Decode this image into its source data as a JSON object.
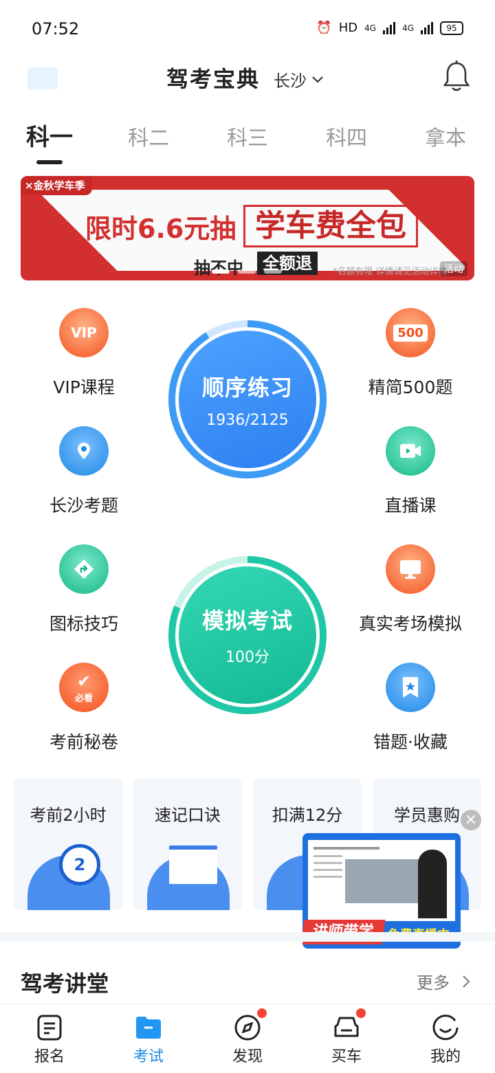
{
  "status_bar": {
    "time": "07:52",
    "network_1": "4G",
    "network_2": "4G",
    "hd": "HD",
    "battery": "95"
  },
  "header": {
    "title": "驾考宝典",
    "city": "长沙"
  },
  "tabs": [
    {
      "label": "科一",
      "active": true
    },
    {
      "label": "科二",
      "active": false
    },
    {
      "label": "科三",
      "active": false
    },
    {
      "label": "科四",
      "active": false
    },
    {
      "label": "拿本",
      "active": false
    }
  ],
  "banner": {
    "tag": "×金秋学车季",
    "main": "限时6.6元抽",
    "box": "学车费全包",
    "sub": "抽不中",
    "sub_box": "全额退",
    "note": "*名额有限 详情请见活动详情",
    "corner": "活动"
  },
  "features": {
    "vip": "VIP课程",
    "jingjian": "精简500题",
    "jingjian_icon": "500",
    "local": "长沙考题",
    "live": "直播课",
    "signs": "图标技巧",
    "real_exam": "真实考场模拟",
    "secret": "考前秘卷",
    "secret_badge": "必看",
    "wrong": "错题·收藏"
  },
  "practice": {
    "title": "顺序练习",
    "progress": "1936/2125",
    "done": 1936,
    "total": 2125
  },
  "mock": {
    "title": "模拟考试",
    "score": "100分"
  },
  "cards": [
    {
      "label": "考前2小时",
      "icon_text": "2"
    },
    {
      "label": "速记口诀"
    },
    {
      "label": "扣满12分"
    },
    {
      "label": "学员惠购"
    }
  ],
  "video": {
    "label_left": "讲师带学",
    "label_right": "免费直播中"
  },
  "section": {
    "title": "驾考讲堂",
    "more": "更多"
  },
  "nav": [
    {
      "label": "报名",
      "icon": "form-icon",
      "active": false,
      "dot": false
    },
    {
      "label": "考试",
      "icon": "folder-icon",
      "active": true,
      "dot": false
    },
    {
      "label": "发现",
      "icon": "compass-icon",
      "active": false,
      "dot": true
    },
    {
      "label": "买车",
      "icon": "car-icon",
      "active": false,
      "dot": true
    },
    {
      "label": "我的",
      "icon": "smile-icon",
      "active": false,
      "dot": false
    }
  ],
  "colors": {
    "accent": "#1e88e5",
    "green": "#1fc7a6",
    "red": "#d32f2f",
    "orange": "#ff7043"
  }
}
